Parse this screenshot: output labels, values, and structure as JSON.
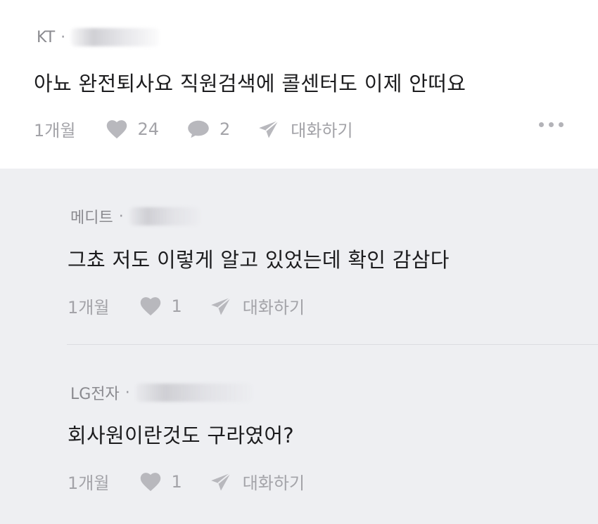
{
  "main_comment": {
    "company": "KT",
    "separator": "·",
    "body": "아뇨 완전퇴사요 직원검색에 콜센터도 이제 안떠요",
    "time": "1개월",
    "likes": "24",
    "replies": "2",
    "reply_label": "대화하기"
  },
  "replies": [
    {
      "company": "메디트",
      "separator": "·",
      "body": "그쵸 저도 이렇게 알고 있었는데 확인 감삼다",
      "time": "1개월",
      "likes": "1",
      "reply_label": "대화하기"
    },
    {
      "company": "LG전자",
      "separator": "·",
      "body": "회사원이란것도 구라였어?",
      "time": "1개월",
      "likes": "1",
      "reply_label": "대화하기"
    }
  ],
  "icons": {
    "like": "heart-icon",
    "comment": "speech-bubble-icon",
    "send": "paper-plane-icon",
    "more": "more-horizontal-icon"
  },
  "colors": {
    "reply_background": "#eeeff2",
    "icon_gray": "#b8b8bd",
    "meta_gray": "#8a8a8f"
  }
}
